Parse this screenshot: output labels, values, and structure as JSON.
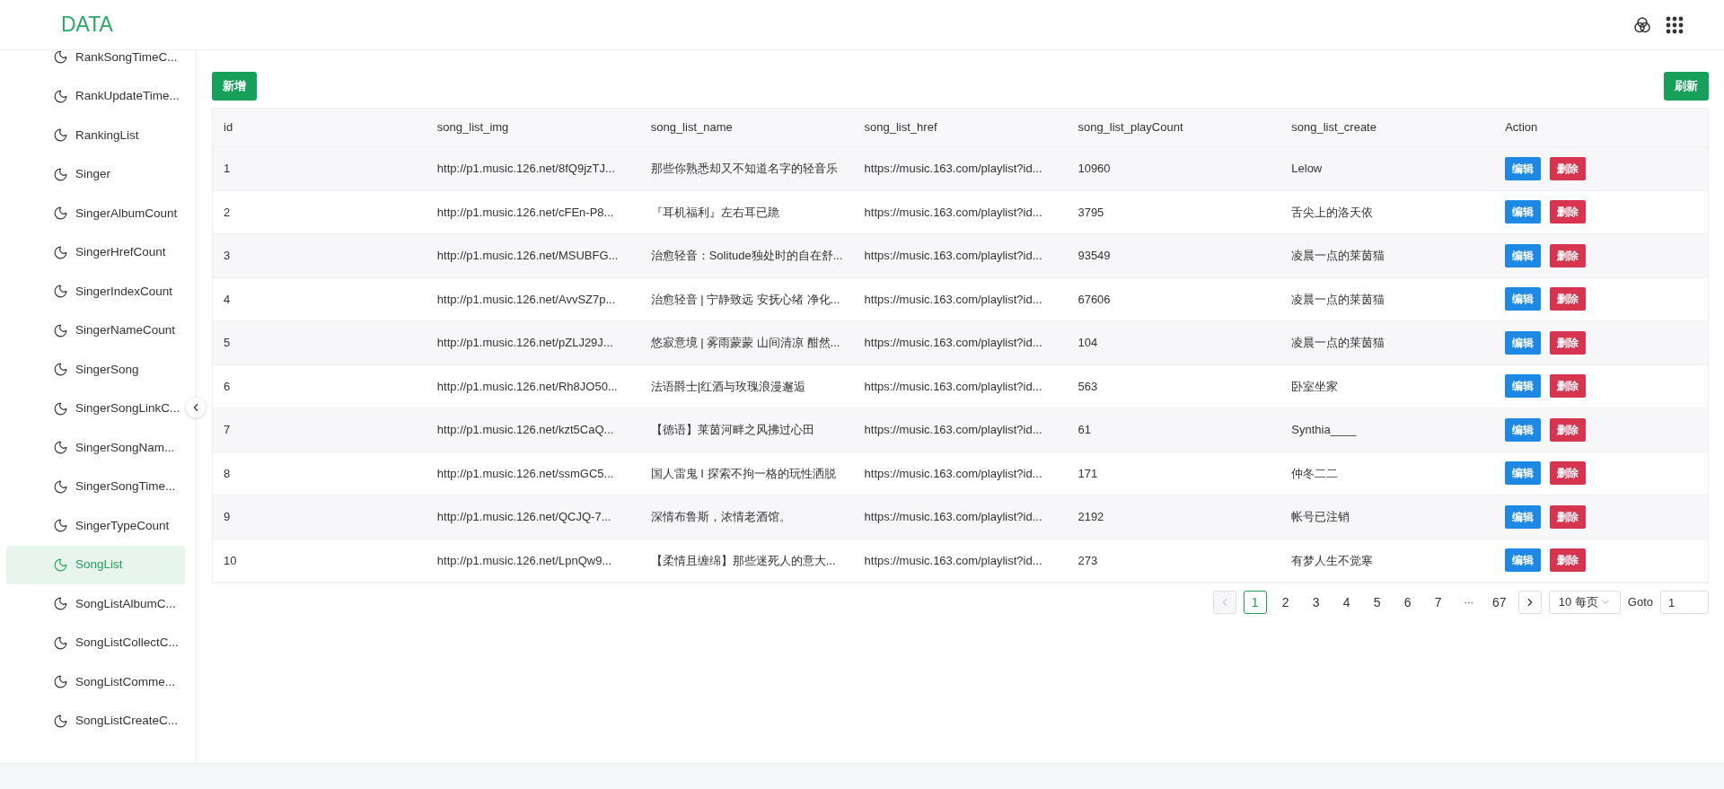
{
  "header": {
    "title": "DATA"
  },
  "sidebar": {
    "items": [
      {
        "label": "RankSongTimeC...",
        "selected": false
      },
      {
        "label": "RankUpdateTime...",
        "selected": false
      },
      {
        "label": "RankingList",
        "selected": false
      },
      {
        "label": "Singer",
        "selected": false
      },
      {
        "label": "SingerAlbumCount",
        "selected": false
      },
      {
        "label": "SingerHrefCount",
        "selected": false
      },
      {
        "label": "SingerIndexCount",
        "selected": false
      },
      {
        "label": "SingerNameCount",
        "selected": false
      },
      {
        "label": "SingerSong",
        "selected": false
      },
      {
        "label": "SingerSongLinkC...",
        "selected": false
      },
      {
        "label": "SingerSongNam...",
        "selected": false
      },
      {
        "label": "SingerSongTime...",
        "selected": false
      },
      {
        "label": "SingerTypeCount",
        "selected": false
      },
      {
        "label": "SongList",
        "selected": true
      },
      {
        "label": "SongListAlbumC...",
        "selected": false
      },
      {
        "label": "SongListCollectC...",
        "selected": false
      },
      {
        "label": "SongListComme...",
        "selected": false
      },
      {
        "label": "SongListCreateC...",
        "selected": false
      }
    ]
  },
  "toolbar": {
    "add_button": "新增",
    "refresh_button": "刷新"
  },
  "table": {
    "columns": [
      "id",
      "song_list_img",
      "song_list_name",
      "song_list_href",
      "song_list_playCount",
      "song_list_create",
      "Action"
    ],
    "rows": [
      {
        "cells": [
          "1",
          "http://p1.music.126.net/8fQ9jzTJ...",
          "那些你熟悉却又不知道名字的轻音乐",
          "https://music.163.com/playlist?id...",
          "10960",
          "Lelow"
        ],
        "actions": [
          {
            "label": "编辑",
            "kind": "edit"
          },
          {
            "label": "删除",
            "kind": "delete"
          }
        ]
      },
      {
        "cells": [
          "2",
          "http://p1.music.126.net/cFEn-P8...",
          "『耳机福利』左右耳已跪",
          "https://music.163.com/playlist?id...",
          "3795",
          "舌尖上的洛天依"
        ],
        "actions": [
          {
            "label": "编辑",
            "kind": "edit"
          },
          {
            "label": "删除",
            "kind": "delete"
          }
        ]
      },
      {
        "cells": [
          "3",
          "http://p1.music.126.net/MSUBFG...",
          "治愈轻音：Solitude独处时的自在舒...",
          "https://music.163.com/playlist?id...",
          "93549",
          "凌晨一点的莱茵猫"
        ],
        "actions": [
          {
            "label": "编辑",
            "kind": "edit"
          },
          {
            "label": "删除",
            "kind": "delete"
          }
        ]
      },
      {
        "cells": [
          "4",
          "http://p1.music.126.net/AvvSZ7p...",
          "治愈轻音 | 宁静致远 安抚心绪 净化...",
          "https://music.163.com/playlist?id...",
          "67606",
          "凌晨一点的莱茵猫"
        ],
        "actions": [
          {
            "label": "编辑",
            "kind": "edit"
          },
          {
            "label": "删除",
            "kind": "delete"
          }
        ]
      },
      {
        "cells": [
          "5",
          "http://p1.music.126.net/pZLJ29J...",
          "悠寂意境 | 雾雨蒙蒙 山间清凉 酣然...",
          "https://music.163.com/playlist?id...",
          "104",
          "凌晨一点的莱茵猫"
        ],
        "actions": [
          {
            "label": "编辑",
            "kind": "edit"
          },
          {
            "label": "删除",
            "kind": "delete"
          }
        ]
      },
      {
        "cells": [
          "6",
          "http://p1.music.126.net/Rh8JO50...",
          "法语爵士|红酒与玫瑰浪漫邂逅",
          "https://music.163.com/playlist?id...",
          "563",
          "卧室坐家"
        ],
        "actions": [
          {
            "label": "编辑",
            "kind": "edit"
          },
          {
            "label": "删除",
            "kind": "delete"
          }
        ]
      },
      {
        "cells": [
          "7",
          "http://p1.music.126.net/kzt5CaQ...",
          "【德语】莱茵河畔之风拂过心田",
          "https://music.163.com/playlist?id...",
          "61",
          "Synthia____"
        ],
        "actions": [
          {
            "label": "编辑",
            "kind": "edit"
          },
          {
            "label": "删除",
            "kind": "delete"
          }
        ]
      },
      {
        "cells": [
          "8",
          "http://p1.music.126.net/ssmGC5...",
          "国人雷鬼 I 探索不拘一格的玩性洒脱",
          "https://music.163.com/playlist?id...",
          "171",
          "仲冬二二"
        ],
        "actions": [
          {
            "label": "编辑",
            "kind": "edit"
          },
          {
            "label": "删除",
            "kind": "delete"
          }
        ]
      },
      {
        "cells": [
          "9",
          "http://p1.music.126.net/QCJQ-7...",
          "深情布鲁斯，浓情老酒馆。",
          "https://music.163.com/playlist?id...",
          "2192",
          "帐号已注销"
        ],
        "actions": [
          {
            "label": "编辑",
            "kind": "edit"
          },
          {
            "label": "删除",
            "kind": "delete"
          }
        ]
      },
      {
        "cells": [
          "10",
          "http://p1.music.126.net/LpnQw9...",
          "【柔情且缠绵】那些迷死人的意大...",
          "https://music.163.com/playlist?id...",
          "273",
          "有梦人生不觉寒"
        ],
        "actions": [
          {
            "label": "编辑",
            "kind": "edit"
          },
          {
            "label": "删除",
            "kind": "delete"
          }
        ]
      }
    ]
  },
  "pagination": {
    "prev": {
      "disabled": true
    },
    "next": {
      "disabled": false
    },
    "pages": [
      {
        "label": "1",
        "kind": "page",
        "selected": true
      },
      {
        "label": "2",
        "kind": "page",
        "selected": false
      },
      {
        "label": "3",
        "kind": "page",
        "selected": false
      },
      {
        "label": "4",
        "kind": "page",
        "selected": false
      },
      {
        "label": "5",
        "kind": "page",
        "selected": false
      },
      {
        "label": "6",
        "kind": "page",
        "selected": false
      },
      {
        "label": "7",
        "kind": "page",
        "selected": false
      },
      {
        "label": "···",
        "kind": "ellipsis",
        "selected": false
      },
      {
        "label": "67",
        "kind": "page",
        "selected": false
      }
    ],
    "page_size": "10 每页",
    "goto_label": "Goto",
    "goto_value": "1"
  }
}
